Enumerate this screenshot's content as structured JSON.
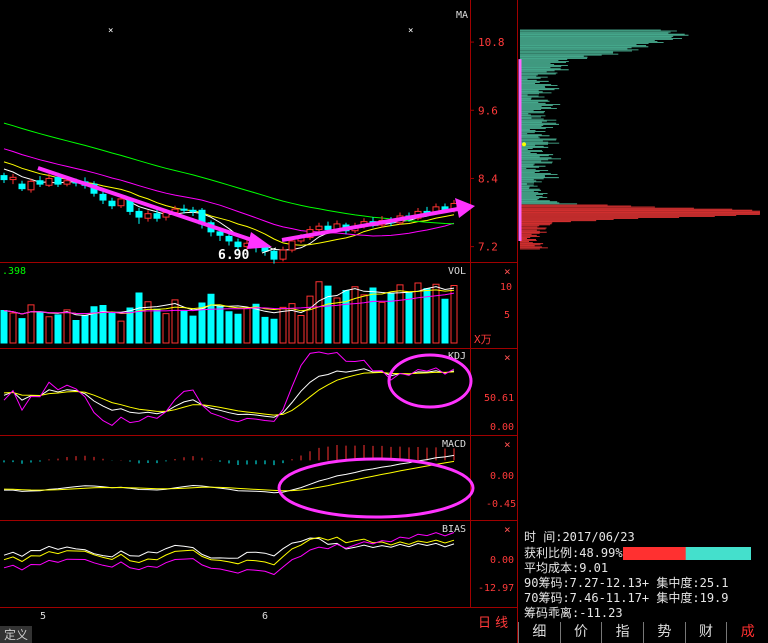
{
  "chart_data": [
    {
      "type": "candlestick",
      "panel": "MA",
      "title": "MA",
      "y_ticks": [
        10.8,
        9.6,
        8.4,
        7.2
      ],
      "ylim": [
        7.0,
        11.4
      ],
      "x_labels": [
        "5",
        "6"
      ],
      "low_annotation": "6.90",
      "candles": [
        [
          8.45,
          8.38,
          8.5,
          8.32
        ],
        [
          8.38,
          8.42,
          8.48,
          8.3
        ],
        [
          8.3,
          8.22,
          8.36,
          8.18
        ],
        [
          8.2,
          8.35,
          8.4,
          8.15
        ],
        [
          8.36,
          8.3,
          8.44,
          8.25
        ],
        [
          8.28,
          8.4,
          8.48,
          8.25
        ],
        [
          8.42,
          8.3,
          8.5,
          8.25
        ],
        [
          8.3,
          8.36,
          8.42,
          8.26
        ],
        [
          8.34,
          8.32,
          8.4,
          8.26
        ],
        [
          8.34,
          8.28,
          8.42,
          8.22
        ],
        [
          8.3,
          8.14,
          8.35,
          8.08
        ],
        [
          8.12,
          8.02,
          8.2,
          7.95
        ],
        [
          8.0,
          7.92,
          8.06,
          7.86
        ],
        [
          7.92,
          8.04,
          8.1,
          7.88
        ],
        [
          8.02,
          7.82,
          8.06,
          7.76
        ],
        [
          7.82,
          7.72,
          7.88,
          7.6
        ],
        [
          7.7,
          7.78,
          7.84,
          7.64
        ],
        [
          7.78,
          7.7,
          7.86,
          7.64
        ],
        [
          7.72,
          7.8,
          7.86,
          7.66
        ],
        [
          7.8,
          7.86,
          7.92,
          7.74
        ],
        [
          7.86,
          7.84,
          7.94,
          7.78
        ],
        [
          7.84,
          7.82,
          7.9,
          7.74
        ],
        [
          7.84,
          7.6,
          7.88,
          7.52
        ],
        [
          7.62,
          7.46,
          7.66,
          7.38
        ],
        [
          7.46,
          7.4,
          7.52,
          7.3
        ],
        [
          7.38,
          7.3,
          7.44,
          7.22
        ],
        [
          7.28,
          7.2,
          7.34,
          7.12
        ],
        [
          7.2,
          7.26,
          7.32,
          7.12
        ],
        [
          7.26,
          7.2,
          7.3,
          7.1
        ],
        [
          7.2,
          7.12,
          7.26,
          7.04
        ],
        [
          7.12,
          6.98,
          7.14,
          6.9
        ],
        [
          6.98,
          7.14,
          7.2,
          6.94
        ],
        [
          7.14,
          7.3,
          7.36,
          7.1
        ],
        [
          7.3,
          7.36,
          7.42,
          7.26
        ],
        [
          7.36,
          7.5,
          7.56,
          7.32
        ],
        [
          7.5,
          7.56,
          7.62,
          7.44
        ],
        [
          7.56,
          7.5,
          7.64,
          7.46
        ],
        [
          7.5,
          7.6,
          7.66,
          7.46
        ],
        [
          7.58,
          7.48,
          7.62,
          7.42
        ],
        [
          7.48,
          7.56,
          7.62,
          7.44
        ],
        [
          7.56,
          7.64,
          7.7,
          7.52
        ],
        [
          7.64,
          7.58,
          7.72,
          7.54
        ],
        [
          7.58,
          7.66,
          7.74,
          7.54
        ],
        [
          7.66,
          7.62,
          7.72,
          7.56
        ],
        [
          7.62,
          7.74,
          7.8,
          7.58
        ],
        [
          7.74,
          7.7,
          7.8,
          7.64
        ],
        [
          7.7,
          7.82,
          7.88,
          7.66
        ],
        [
          7.82,
          7.8,
          7.9,
          7.74
        ],
        [
          7.8,
          7.9,
          7.96,
          7.76
        ],
        [
          7.9,
          7.84,
          7.96,
          7.8
        ],
        [
          7.84,
          7.96,
          8.02,
          7.8
        ]
      ],
      "chip_distribution": {
        "rows": 210,
        "peak_price_upper": 10.9,
        "peak_price_lower": 7.8,
        "current_price": 7.95
      }
    },
    {
      "type": "bar",
      "panel": "VOL",
      "title": "VOL",
      "left_value": ".398",
      "y_ticks": [
        10,
        5
      ],
      "unit": "X万",
      "values": [
        5.2,
        4.8,
        3.9,
        6.1,
        5.0,
        4.2,
        4.5,
        5.3,
        3.6,
        4.4,
        5.8,
        6.0,
        4.9,
        3.5,
        5.6,
        8.0,
        6.6,
        5.4,
        4.7,
        6.9,
        5.1,
        4.3,
        6.4,
        7.8,
        5.9,
        5.0,
        4.6,
        5.5,
        6.2,
        4.1,
        3.8,
        5.7,
        6.3,
        4.4,
        7.5,
        9.8,
        9.1,
        7.2,
        8.4,
        9.0,
        7.7,
        8.8,
        6.5,
        7.9,
        9.3,
        8.1,
        9.6,
        8.7,
        9.4,
        7.0,
        9.2
      ]
    },
    {
      "type": "line",
      "panel": "KDJ",
      "title": "KDJ",
      "y_ticks": [
        50.61,
        0.0
      ],
      "y_tick_labels": [
        "50.61",
        "0.00"
      ],
      "ylim": [
        -5,
        110
      ]
    },
    {
      "type": "line",
      "panel": "MACD",
      "title": "MACD",
      "y_ticks": [
        0.0,
        -0.45
      ],
      "y_tick_labels": [
        "0.00",
        "-0.45"
      ],
      "ylim": [
        -0.62,
        0.22
      ]
    },
    {
      "type": "line",
      "panel": "BIAS",
      "title": "BIAS",
      "y_ticks": [
        0.0,
        -12.97
      ],
      "y_tick_labels": [
        "0.00",
        "-12.97"
      ],
      "ylim": [
        -20,
        8
      ]
    }
  ],
  "info": {
    "time_label": "时      间:",
    "time_value": "2017/06/23",
    "profit_label": "获利比例:",
    "profit_value": "48.99%",
    "profit_ratio": 0.4899,
    "avg_cost_label": "平均成本:",
    "avg_cost_value": "9.01",
    "chip90": "90筹码:7.27-12.13+ 集中度:25.1",
    "chip70": "70筹码:7.46-11.17+ 集中度:19.9",
    "chip_divergence": "筹码乖离:-11.23"
  },
  "bottom": {
    "left_label": "定义",
    "period_label": "日 线",
    "tabs": [
      "细",
      "价",
      "指",
      "势",
      "财",
      "成"
    ]
  },
  "colors": {
    "up": "#ff3232",
    "down": "#00ffff",
    "ma_white": "#ffffff",
    "ma_yellow": "#ffff00",
    "ma_magenta": "#ff00ff",
    "ma_green": "#00ff00",
    "annotation": "#ff33ff",
    "axis": "#a00000",
    "chip_upper": "#55ccaa",
    "chip_lower": "#ff3a3a"
  }
}
